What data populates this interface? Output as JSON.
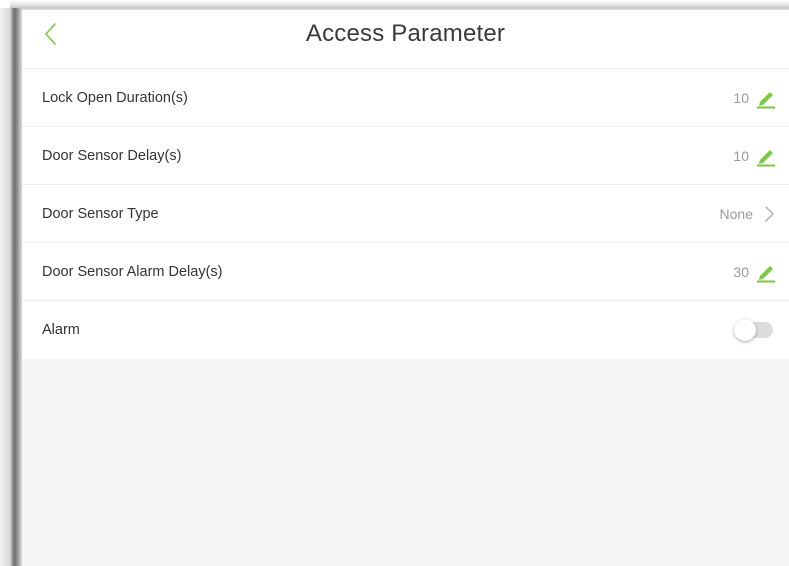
{
  "header": {
    "title": "Access Parameter",
    "back_icon": "chevron-left-icon"
  },
  "rows": [
    {
      "label": "Lock Open Duration(s)",
      "value": "10",
      "control": "edit",
      "icon": "pencil-icon"
    },
    {
      "label": "Door Sensor Delay(s)",
      "value": "10",
      "control": "edit",
      "icon": "pencil-icon"
    },
    {
      "label": "Door Sensor Type",
      "value": "None",
      "control": "select",
      "icon": "chevron-right-icon"
    },
    {
      "label": "Door Sensor Alarm Delay(s)",
      "value": "30",
      "control": "edit",
      "icon": "pencil-icon"
    },
    {
      "label": "Alarm",
      "control": "toggle",
      "checked": false
    }
  ],
  "colors": {
    "accent": "#7ac943",
    "background": "#f5f5f5",
    "text": "#333333",
    "value_text": "#9a9a9a"
  }
}
